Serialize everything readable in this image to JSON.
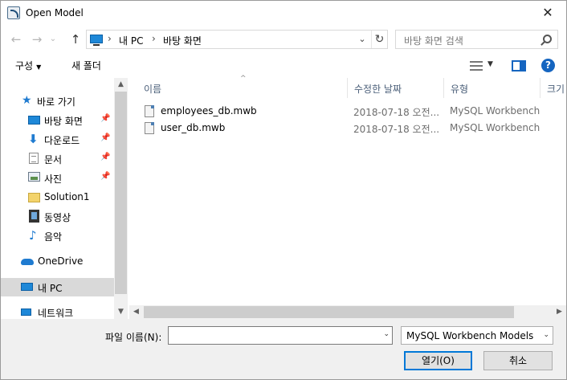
{
  "window": {
    "title": "Open Model"
  },
  "nav": {
    "back_symbol": "←",
    "forward_symbol": "→",
    "up_symbol": "↑",
    "breadcrumb": [
      "내 PC",
      "바탕 화면"
    ],
    "refresh_symbol": "↻",
    "search_placeholder": "바탕 화면 검색"
  },
  "toolbar": {
    "organize_label": "구성",
    "new_folder_label": "새 폴더",
    "help_symbol": "?"
  },
  "sidebar": {
    "items": [
      {
        "label": "바로 가기",
        "icon": "star-icon"
      },
      {
        "label": "바탕 화면",
        "icon": "desktop-icon",
        "pinned": true
      },
      {
        "label": "다운로드",
        "icon": "download-icon",
        "pinned": true
      },
      {
        "label": "문서",
        "icon": "document-icon",
        "pinned": true
      },
      {
        "label": "사진",
        "icon": "picture-icon",
        "pinned": true
      },
      {
        "label": "Solution1",
        "icon": "folder-icon"
      },
      {
        "label": "동영상",
        "icon": "video-icon"
      },
      {
        "label": "음악",
        "icon": "music-icon"
      },
      {
        "label": "OneDrive",
        "icon": "cloud-icon"
      },
      {
        "label": "내 PC",
        "icon": "pc-icon",
        "selected": true
      },
      {
        "label": "네트워크",
        "icon": "network-icon"
      }
    ]
  },
  "file_list": {
    "columns": [
      "이름",
      "수정한 날짜",
      "유형",
      "크기"
    ],
    "rows": [
      {
        "name": "employees_db.mwb",
        "date": "2018-07-18 오전...",
        "type": "MySQL Workbench..."
      },
      {
        "name": "user_db.mwb",
        "date": "2018-07-18 오전...",
        "type": "MySQL Workbench..."
      }
    ]
  },
  "footer": {
    "filename_label": "파일 이름(N):",
    "filename_value": "",
    "filter_value": "MySQL Workbench Models (*.",
    "open_label": "열기(O)",
    "cancel_label": "취소"
  }
}
